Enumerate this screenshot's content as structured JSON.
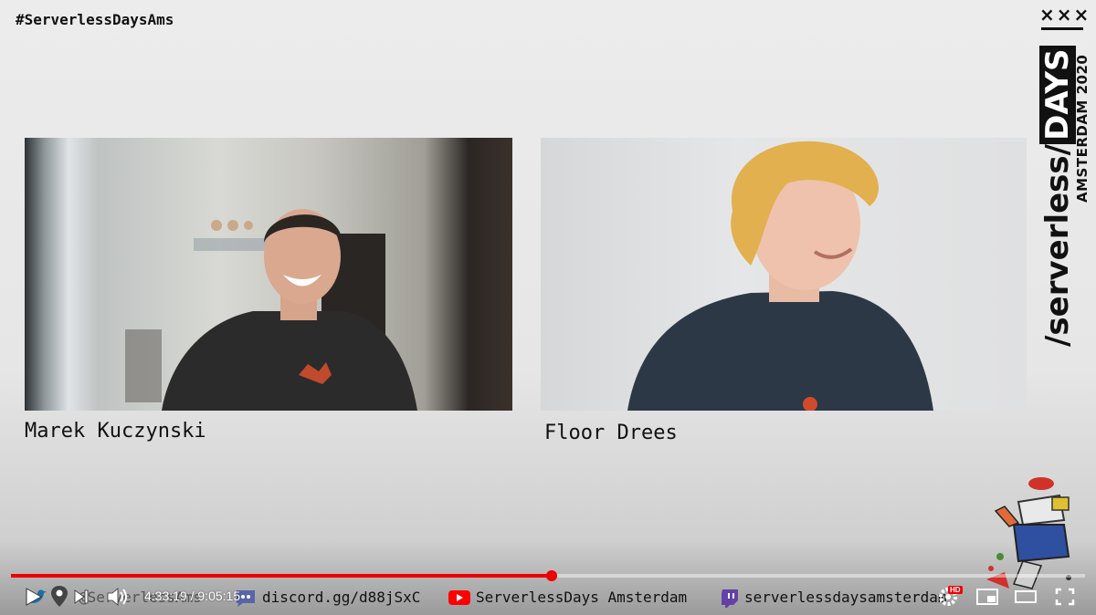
{
  "hashtag": "#ServerlessDaysAms",
  "branding": {
    "xxx": "×××",
    "main_prefix": "/serverless/",
    "main_days": "DAYS",
    "sub": "AMSTERDAM 2020"
  },
  "participants": [
    {
      "name": "Marek Kuczynski"
    },
    {
      "name": "Floor Drees"
    }
  ],
  "player": {
    "progress_fraction": 0.503,
    "current_time": "4:33:19",
    "time_separator": " / ",
    "duration": "9:05:15",
    "hd_badge": "HD"
  },
  "banner": {
    "twitter_text": "@ServerlessAms",
    "discord_text": "discord.gg/d88jSxC",
    "youtube_text": "ServerlessDays Amsterdam",
    "twitch_text": "serverlessdaysamsterdam"
  },
  "colors": {
    "accent_red": "#ee0000",
    "discord_blue": "#5865a8",
    "youtube_red": "#ff0000",
    "twitch_purple": "#6441a5"
  }
}
